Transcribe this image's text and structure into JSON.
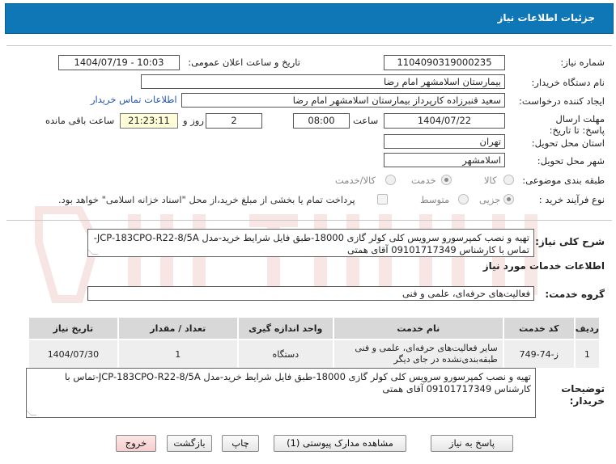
{
  "header": {
    "title": "جزئیات اطلاعات نیاز"
  },
  "form": {
    "need_number_label": "شماره نیاز:",
    "need_number": "1104090319000235",
    "announce_label": "تاریخ و ساعت اعلان عمومی:",
    "announce_value": "1404/07/19 - 10:03",
    "buyer_label": "نام دستگاه خریدار:",
    "buyer_value": "بیمارستان اسلامشهر   امام رضا",
    "creator_label": "ایجاد کننده درخواست:",
    "creator_value": "سعید قنبرزاده کارپرداز بیمارستان اسلامشهر   امام رضا",
    "contact_link": "اطلاعات تماس خریدار",
    "deadline_label": "مهلت ارسال پاسخ: تا تاریخ:",
    "deadline_date": "1404/07/22",
    "time_label": "ساعت",
    "deadline_time": "08:00",
    "days_value": "2",
    "days_label": "روز و",
    "remaining_time": "21:23:11",
    "remaining_label": "ساعت باقی مانده",
    "province_label": "استان محل تحویل:",
    "province_value": "تهران",
    "city_label": "شهر محل تحویل:",
    "city_value": "اسلامشهر",
    "category_label": "طبقه بندی موضوعی:",
    "category_options": [
      "کالا",
      "خدمت",
      "کالا/خدمت"
    ],
    "category_selected": "خدمت",
    "process_label": "نوع فرآیند خرید :",
    "process_options": [
      "جزیی",
      "متوسط"
    ],
    "process_selected": "جزیی",
    "treasury_note": "پرداخت تمام یا بخشی از مبلغ خرید،از محل \"اسناد خزانه اسلامی\" خواهد بود."
  },
  "description": {
    "label": "شرح کلی نیاز:",
    "text": "تهیه و نصب کمپرسورو سرویس کلی کولر گازی 18000-طبق فایل شرایط خرید-مدل JCP-183CPO-R22-8/5A-تماس با کارشناس 09101717349 آقای همتی"
  },
  "services": {
    "section_title": "اطلاعات خدمات مورد نیاز",
    "group_label": "گروه خدمت:",
    "group_value": "فعالیت‌های حرفه‌ای، علمی و فنی",
    "columns": [
      "ردیف",
      "کد خدمت",
      "نام خدمت",
      "واحد اندازه گیری",
      "تعداد / مقدار",
      "تاریخ نیاز"
    ],
    "rows": [
      {
        "row": "1",
        "code": "ز-74-749",
        "name": "سایر فعالیت‌های حرفه‌ای، علمی و فنی طبقه‌بندی‌نشده در جای دیگر",
        "unit": "دستگاه",
        "qty": "1",
        "date": "1404/07/30"
      }
    ]
  },
  "buyer_notes": {
    "label": "توضیحات خریدار:",
    "text": "تهیه و نصب کمپرسورو سرویس کلی کولر گازی 18000-طبق فایل شرایط خرید-مدل JCP-183CPO-R22-8/5A-تماس با کارشناس 09101717349 آقای همتی"
  },
  "buttons": {
    "reply": "پاسخ به نیاز",
    "attachments": "مشاهده مدارک پیوستی (1)",
    "print": "چاپ",
    "back": "بازگشت",
    "exit": "خروج"
  },
  "colors": {
    "header_bg": "#0f77b6",
    "link": "#1f55b0",
    "watermark": "#e9a3a3"
  }
}
